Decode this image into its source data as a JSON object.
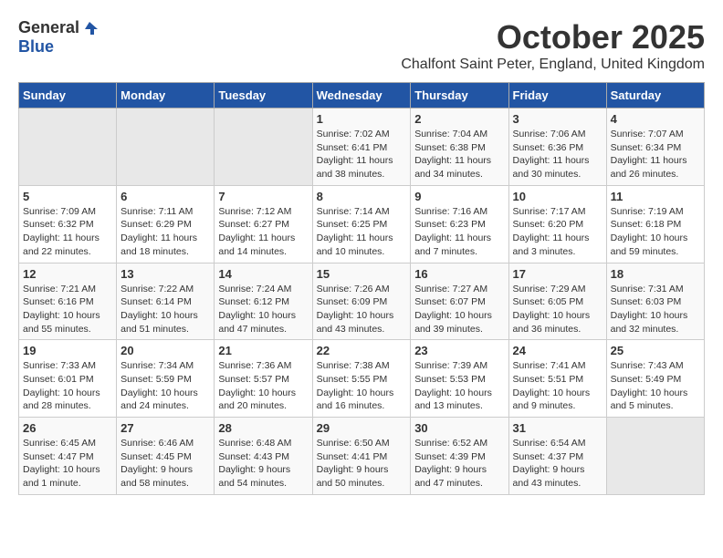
{
  "logo": {
    "general": "General",
    "blue": "Blue"
  },
  "title": "October 2025",
  "location": "Chalfont Saint Peter, England, United Kingdom",
  "headers": [
    "Sunday",
    "Monday",
    "Tuesday",
    "Wednesday",
    "Thursday",
    "Friday",
    "Saturday"
  ],
  "weeks": [
    [
      {
        "day": "",
        "info": ""
      },
      {
        "day": "",
        "info": ""
      },
      {
        "day": "",
        "info": ""
      },
      {
        "day": "1",
        "info": "Sunrise: 7:02 AM\nSunset: 6:41 PM\nDaylight: 11 hours\nand 38 minutes."
      },
      {
        "day": "2",
        "info": "Sunrise: 7:04 AM\nSunset: 6:38 PM\nDaylight: 11 hours\nand 34 minutes."
      },
      {
        "day": "3",
        "info": "Sunrise: 7:06 AM\nSunset: 6:36 PM\nDaylight: 11 hours\nand 30 minutes."
      },
      {
        "day": "4",
        "info": "Sunrise: 7:07 AM\nSunset: 6:34 PM\nDaylight: 11 hours\nand 26 minutes."
      }
    ],
    [
      {
        "day": "5",
        "info": "Sunrise: 7:09 AM\nSunset: 6:32 PM\nDaylight: 11 hours\nand 22 minutes."
      },
      {
        "day": "6",
        "info": "Sunrise: 7:11 AM\nSunset: 6:29 PM\nDaylight: 11 hours\nand 18 minutes."
      },
      {
        "day": "7",
        "info": "Sunrise: 7:12 AM\nSunset: 6:27 PM\nDaylight: 11 hours\nand 14 minutes."
      },
      {
        "day": "8",
        "info": "Sunrise: 7:14 AM\nSunset: 6:25 PM\nDaylight: 11 hours\nand 10 minutes."
      },
      {
        "day": "9",
        "info": "Sunrise: 7:16 AM\nSunset: 6:23 PM\nDaylight: 11 hours\nand 7 minutes."
      },
      {
        "day": "10",
        "info": "Sunrise: 7:17 AM\nSunset: 6:20 PM\nDaylight: 11 hours\nand 3 minutes."
      },
      {
        "day": "11",
        "info": "Sunrise: 7:19 AM\nSunset: 6:18 PM\nDaylight: 10 hours\nand 59 minutes."
      }
    ],
    [
      {
        "day": "12",
        "info": "Sunrise: 7:21 AM\nSunset: 6:16 PM\nDaylight: 10 hours\nand 55 minutes."
      },
      {
        "day": "13",
        "info": "Sunrise: 7:22 AM\nSunset: 6:14 PM\nDaylight: 10 hours\nand 51 minutes."
      },
      {
        "day": "14",
        "info": "Sunrise: 7:24 AM\nSunset: 6:12 PM\nDaylight: 10 hours\nand 47 minutes."
      },
      {
        "day": "15",
        "info": "Sunrise: 7:26 AM\nSunset: 6:09 PM\nDaylight: 10 hours\nand 43 minutes."
      },
      {
        "day": "16",
        "info": "Sunrise: 7:27 AM\nSunset: 6:07 PM\nDaylight: 10 hours\nand 39 minutes."
      },
      {
        "day": "17",
        "info": "Sunrise: 7:29 AM\nSunset: 6:05 PM\nDaylight: 10 hours\nand 36 minutes."
      },
      {
        "day": "18",
        "info": "Sunrise: 7:31 AM\nSunset: 6:03 PM\nDaylight: 10 hours\nand 32 minutes."
      }
    ],
    [
      {
        "day": "19",
        "info": "Sunrise: 7:33 AM\nSunset: 6:01 PM\nDaylight: 10 hours\nand 28 minutes."
      },
      {
        "day": "20",
        "info": "Sunrise: 7:34 AM\nSunset: 5:59 PM\nDaylight: 10 hours\nand 24 minutes."
      },
      {
        "day": "21",
        "info": "Sunrise: 7:36 AM\nSunset: 5:57 PM\nDaylight: 10 hours\nand 20 minutes."
      },
      {
        "day": "22",
        "info": "Sunrise: 7:38 AM\nSunset: 5:55 PM\nDaylight: 10 hours\nand 16 minutes."
      },
      {
        "day": "23",
        "info": "Sunrise: 7:39 AM\nSunset: 5:53 PM\nDaylight: 10 hours\nand 13 minutes."
      },
      {
        "day": "24",
        "info": "Sunrise: 7:41 AM\nSunset: 5:51 PM\nDaylight: 10 hours\nand 9 minutes."
      },
      {
        "day": "25",
        "info": "Sunrise: 7:43 AM\nSunset: 5:49 PM\nDaylight: 10 hours\nand 5 minutes."
      }
    ],
    [
      {
        "day": "26",
        "info": "Sunrise: 6:45 AM\nSunset: 4:47 PM\nDaylight: 10 hours\nand 1 minute."
      },
      {
        "day": "27",
        "info": "Sunrise: 6:46 AM\nSunset: 4:45 PM\nDaylight: 9 hours\nand 58 minutes."
      },
      {
        "day": "28",
        "info": "Sunrise: 6:48 AM\nSunset: 4:43 PM\nDaylight: 9 hours\nand 54 minutes."
      },
      {
        "day": "29",
        "info": "Sunrise: 6:50 AM\nSunset: 4:41 PM\nDaylight: 9 hours\nand 50 minutes."
      },
      {
        "day": "30",
        "info": "Sunrise: 6:52 AM\nSunset: 4:39 PM\nDaylight: 9 hours\nand 47 minutes."
      },
      {
        "day": "31",
        "info": "Sunrise: 6:54 AM\nSunset: 4:37 PM\nDaylight: 9 hours\nand 43 minutes."
      },
      {
        "day": "",
        "info": ""
      }
    ]
  ]
}
